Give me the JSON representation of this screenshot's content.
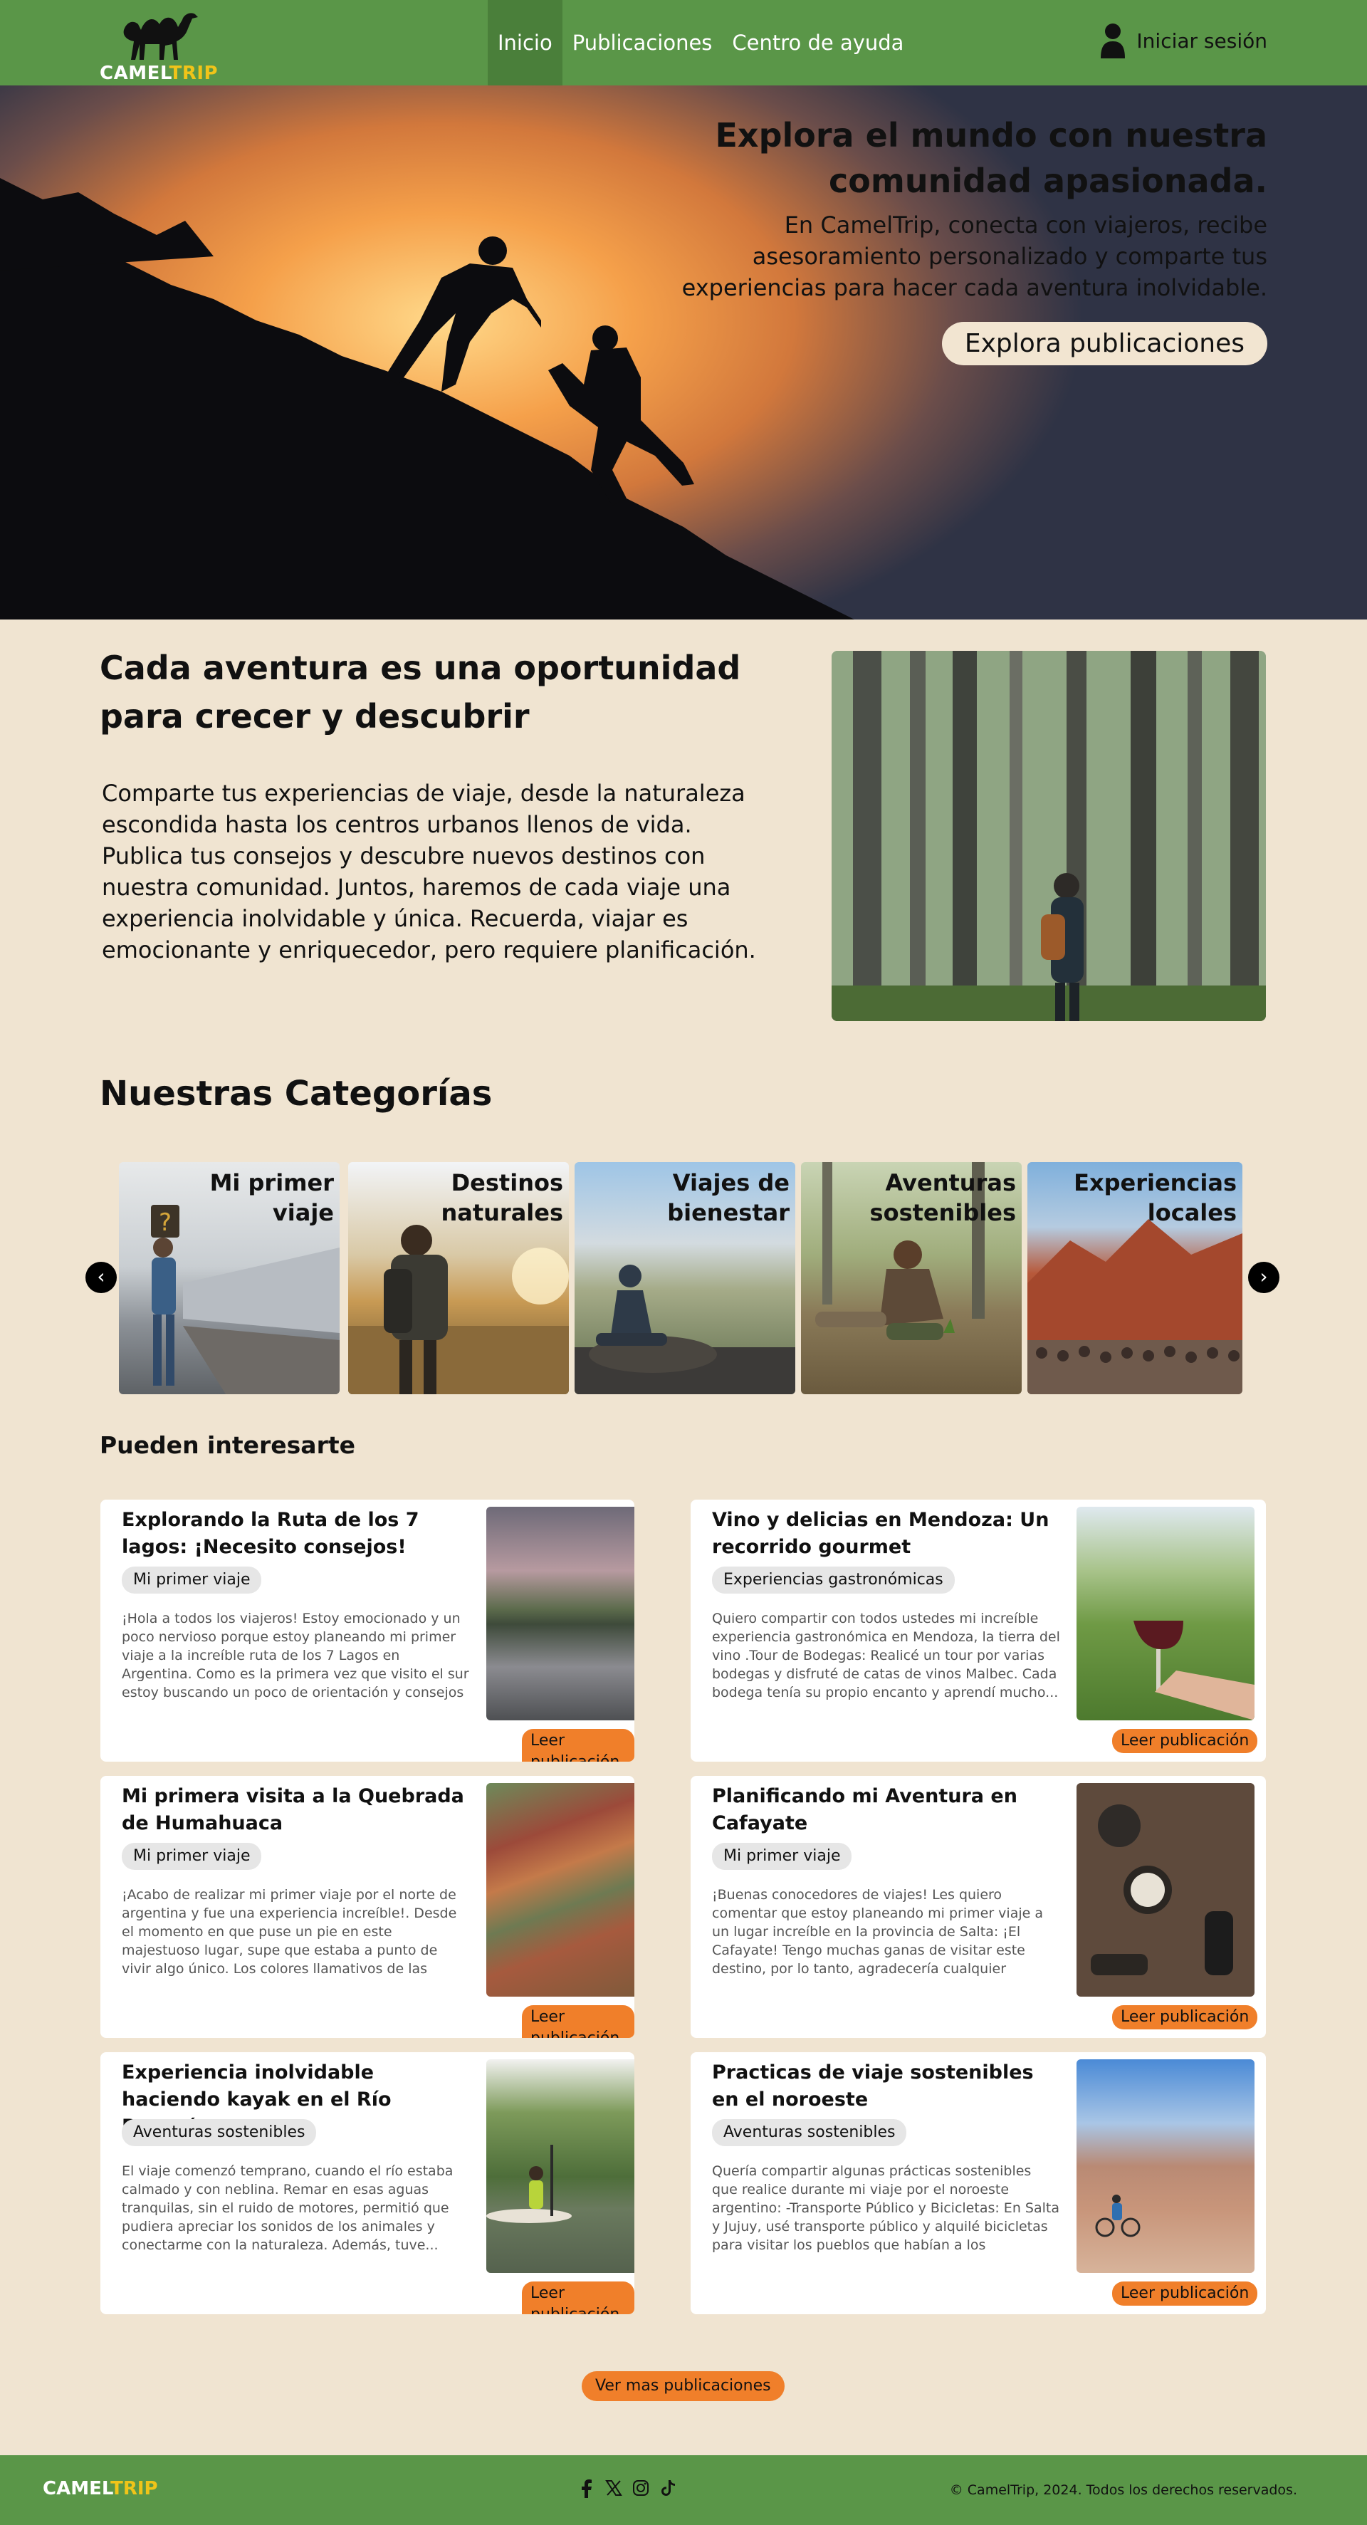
{
  "brand": {
    "name_part1": "CAMEL",
    "name_part2": "TRIP"
  },
  "nav": {
    "links": [
      {
        "label": "Inicio"
      },
      {
        "label": "Publicaciones"
      },
      {
        "label": "Centro de ayuda"
      }
    ],
    "login_label": "Iniciar sesión"
  },
  "hero": {
    "title": "Explora el mundo con nuestra comunidad apasionada.",
    "subtitle": "En CamelTrip, conecta con viajeros, recibe asesoramiento personalizado y comparte tus experiencias para hacer cada aventura inolvidable.",
    "button_label": "Explora publicaciones"
  },
  "about": {
    "title": "Cada aventura es una oportunidad para crecer y descubrir",
    "body": "Comparte tus experiencias de viaje, desde la naturaleza escondida hasta los centros urbanos llenos de vida. Publica tus consejos y descubre nuevos destinos con nuestra comunidad. Juntos, haremos de cada viaje una experiencia inolvidable y única. Recuerda, viajar es emocionante y enriquecedor, pero requiere planificación."
  },
  "categories": {
    "title": "Nuestras Categorías",
    "items": [
      {
        "label": "Mi primer viaje"
      },
      {
        "label": "Destinos naturales"
      },
      {
        "label": "Viajes de bienestar"
      },
      {
        "label": "Aventuras sostenibles"
      },
      {
        "label": "Experiencias locales"
      }
    ]
  },
  "interest": {
    "title": "Pueden interesarte",
    "read_label": "Leer publicación",
    "cards": [
      {
        "title": "Explorando la Ruta de los 7 lagos: ¡Necesito consejos!",
        "tag": "Mi primer viaje",
        "excerpt": "¡Hola a todos los viajeros! Estoy emocionado y un poco nervioso porque estoy planeando mi primer viaje a la increíble ruta de los 7 Lagos en Argentina. Como es la primera vez que visito el sur estoy buscando un poco de orientación y consejos de..."
      },
      {
        "title": "Vino y delicias en Mendoza: Un recorrido gourmet",
        "tag": "Experiencias gastronómicas",
        "excerpt": "Quiero compartir con todos ustedes mi increíble experiencia gastronómica en Mendoza, la tierra del vino .Tour de Bodegas: Realicé un tour por varias bodegas y disfruté de catas de vinos Malbec. Cada bodega tenía su propio encanto y aprendí mucho..."
      },
      {
        "title": "Mi primera visita a la Quebrada de Humahuaca",
        "tag": "Mi primer viaje",
        "excerpt": "¡Acabo de realizar mi primer viaje por el norte de argentina y fue una experiencia increíble!. Desde el momento en que puse un pie en este majestuoso lugar, supe que estaba a punto de vivir algo único. Los colores llamativos de las montañas..."
      },
      {
        "title": "Planificando mi Aventura en Cafayate",
        "tag": "Mi primer viaje",
        "excerpt": "¡Buenas conocedores de viajes! Les quiero comentar que estoy planeando mi primer viaje a un lugar increíble en la provincia de Salta: ¡El Cafayate! Tengo muchas ganas de visitar este destino, por lo tanto, agradecería cualquier consejo o recomendación..."
      },
      {
        "title": "Experiencia inolvidable haciendo kayak en el Río Paraná",
        "tag": "Aventuras sostenibles",
        "excerpt": "El viaje comenzó temprano, cuando el río estaba calmado y con neblina. Remar en esas aguas tranquilas, sin el ruido de motores, permitió que pudiera apreciar los sonidos de los animales y conectarme con la naturaleza. Además, tuve..."
      },
      {
        "title": "Practicas de viaje sostenibles en el noroeste",
        "tag": "Aventuras sostenibles",
        "excerpt": "Quería compartir algunas prácticas sostenibles que realice durante mi viaje por el noroeste argentino: -Transporte Público y Bicicletas: En Salta y Jujuy, usé transporte público y alquilé bicicletas para visitar los pueblos que habían a los alrededores..."
      }
    ],
    "more_label": "Ver mas publicaciones"
  },
  "footer": {
    "copyright": "© CamelTrip, 2024. Todos los derechos reservados.",
    "social_icons": [
      "facebook-icon",
      "x-icon",
      "instagram-icon",
      "tiktok-icon"
    ]
  },
  "colors": {
    "nav_green": "#5a9648",
    "accent_orange": "#f07f2a",
    "background": "#f0e4d1",
    "logo_yellow": "#f0c419"
  }
}
